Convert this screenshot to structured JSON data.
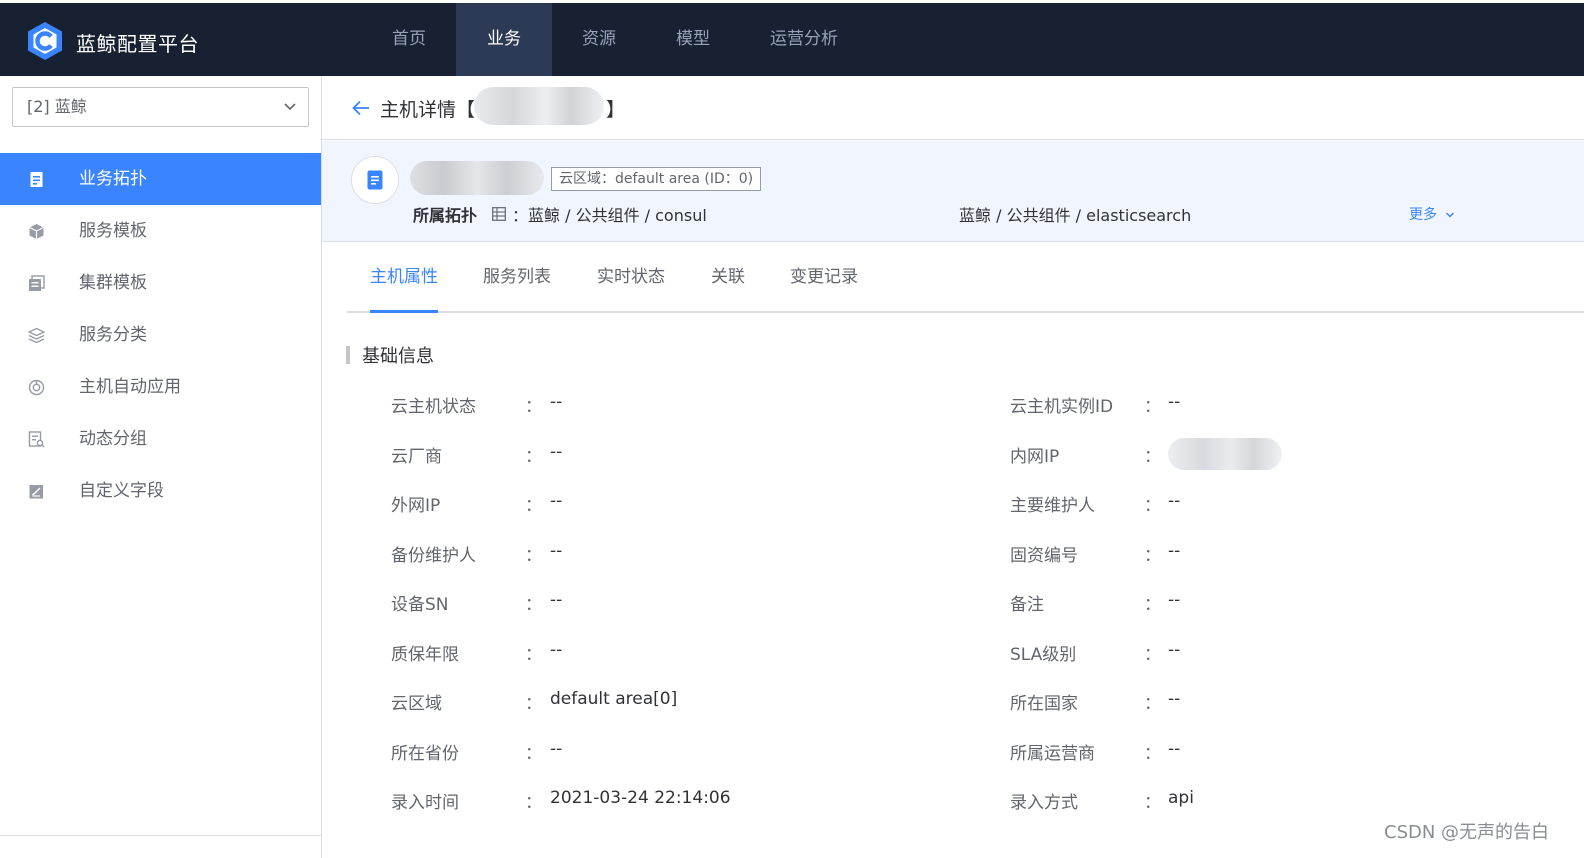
{
  "app": {
    "title": "蓝鲸配置平台"
  },
  "nav": [
    {
      "label": "首页",
      "active": false
    },
    {
      "label": "业务",
      "active": true
    },
    {
      "label": "资源",
      "active": false
    },
    {
      "label": "模型",
      "active": false
    },
    {
      "label": "运营分析",
      "active": false
    }
  ],
  "sidebar": {
    "business_select": "[2] 蓝鲸",
    "items": [
      {
        "label": "业务拓扑",
        "icon": "topology-doc-icon",
        "active": true
      },
      {
        "label": "服务模板",
        "icon": "cube-icon",
        "active": false
      },
      {
        "label": "集群模板",
        "icon": "cluster-icon",
        "active": false
      },
      {
        "label": "服务分类",
        "icon": "layers-icon",
        "active": false
      },
      {
        "label": "主机自动应用",
        "icon": "auto-apply-icon",
        "active": false
      },
      {
        "label": "动态分组",
        "icon": "dynamic-group-icon",
        "active": false
      },
      {
        "label": "自定义字段",
        "icon": "custom-field-icon",
        "active": false
      }
    ]
  },
  "header": {
    "title": "主机详情【",
    "title_close": "】"
  },
  "host": {
    "cloud_tag": "云区域：default area (ID：0)",
    "topology_label": "所属拓扑",
    "topology_path_1": "：蓝鲸 / 公共组件 / consul",
    "topology_path_2": "蓝鲸 / 公共组件 / elasticsearch",
    "more_label": "更多"
  },
  "tabs": [
    {
      "label": "主机属性",
      "active": true
    },
    {
      "label": "服务列表",
      "active": false
    },
    {
      "label": "实时状态",
      "active": false
    },
    {
      "label": "关联",
      "active": false
    },
    {
      "label": "变更记录",
      "active": false
    }
  ],
  "section": {
    "title": "基础信息"
  },
  "fields": {
    "left": [
      {
        "label": "云主机状态",
        "value": "--"
      },
      {
        "label": "云厂商",
        "value": "--"
      },
      {
        "label": "外网IP",
        "value": "--"
      },
      {
        "label": "备份维护人",
        "value": "--"
      },
      {
        "label": "设备SN",
        "value": "--"
      },
      {
        "label": "质保年限",
        "value": "--"
      },
      {
        "label": "云区域",
        "value": "default area[0]"
      },
      {
        "label": "所在省份",
        "value": "--"
      },
      {
        "label": "录入时间",
        "value": "2021-03-24 22:14:06"
      }
    ],
    "right": [
      {
        "label": "云主机实例ID",
        "value": "--"
      },
      {
        "label": "内网IP",
        "value": ""
      },
      {
        "label": "主要维护人",
        "value": "--"
      },
      {
        "label": "固资编号",
        "value": "--"
      },
      {
        "label": "备注",
        "value": "--"
      },
      {
        "label": "SLA级别",
        "value": "--"
      },
      {
        "label": "所在国家",
        "value": "--"
      },
      {
        "label": "所属运营商",
        "value": "--"
      },
      {
        "label": "录入方式",
        "value": "api"
      }
    ],
    "colon": "："
  },
  "watermark": "CSDN @无声的告白",
  "colors": {
    "primary": "#3a84ff",
    "topbar": "#182132",
    "nav_active": "#2c3a55"
  }
}
